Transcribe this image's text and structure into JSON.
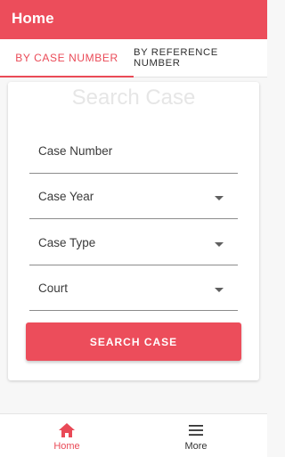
{
  "appbar": {
    "title": "Home"
  },
  "tabs": [
    {
      "label": "BY CASE NUMBER",
      "active": true
    },
    {
      "label": "BY REFERENCE NUMBER",
      "active": false
    }
  ],
  "form": {
    "title": "Search Case",
    "fields": [
      {
        "label": "Case Number",
        "type": "text"
      },
      {
        "label": "Case Year",
        "type": "dropdown"
      },
      {
        "label": "Case Type",
        "type": "dropdown"
      },
      {
        "label": "Court",
        "type": "dropdown"
      }
    ],
    "submit_label": "SEARCH CASE"
  },
  "bottom_nav": {
    "items": [
      {
        "label": "Home",
        "icon": "home-icon",
        "active": true
      },
      {
        "label": "More",
        "icon": "menu-icon",
        "active": false
      }
    ]
  },
  "colors": {
    "accent": "#ec4d5b",
    "active_text": "#e94a57"
  }
}
